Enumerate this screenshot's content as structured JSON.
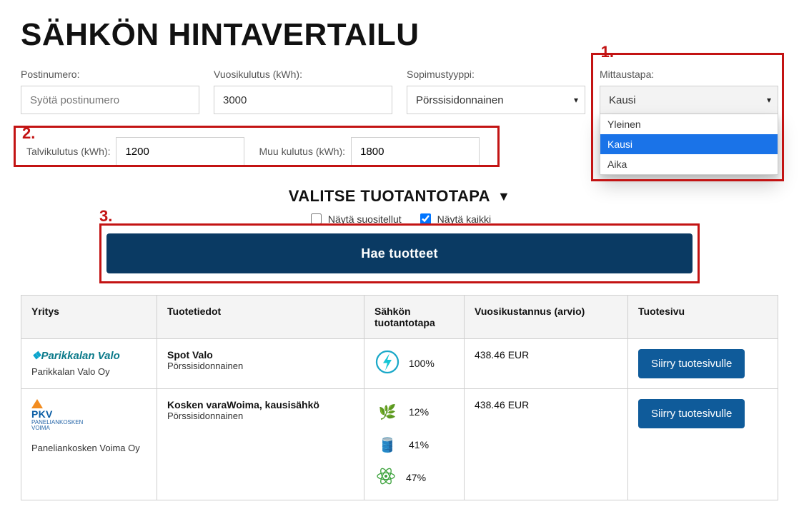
{
  "title": "SÄHKÖN HINTAVERTAILU",
  "annotations": {
    "n1": "1.",
    "n2": "2.",
    "n3": "3."
  },
  "filters": {
    "postal": {
      "label": "Postinumero:",
      "placeholder": "Syötä postinumero",
      "value": ""
    },
    "annual": {
      "label": "Vuosikulutus (kWh):",
      "value": "3000"
    },
    "contract": {
      "label": "Sopimustyyppi:",
      "selected": "Pörssisidonnainen"
    },
    "measurement": {
      "label": "Mittaustapa:",
      "selected": "Kausi",
      "options": [
        "Yleinen",
        "Kausi",
        "Aika"
      ]
    }
  },
  "row2": {
    "winter": {
      "label": "Talvikulutus (kWh):",
      "value": "1200"
    },
    "other": {
      "label": "Muu kulutus (kWh):",
      "value": "1800"
    }
  },
  "section": {
    "production_title": "VALITSE TUOTANTOTAPA"
  },
  "checks": {
    "recommended": {
      "label": "Näytä suositellut",
      "checked": false
    },
    "all": {
      "label": "Näytä kaikki",
      "checked": true
    }
  },
  "buttons": {
    "search": "Hae tuotteet",
    "go": "Siirry tuotesivulle"
  },
  "table": {
    "headers": {
      "company": "Yritys",
      "product": "Tuotetiedot",
      "mix": "Sähkön tuotantotapa",
      "annual_cost": "Vuosikustannus (arvio)",
      "page": "Tuotesivu"
    },
    "rows": [
      {
        "brand": {
          "logo": "parikalan-valo",
          "text": "Parikkalan Valo"
        },
        "company": "Parikkalan Valo Oy",
        "product_title": "Spot Valo",
        "product_sub": "Pörssisidonnainen",
        "mix": [
          {
            "icon": "bolt",
            "pct": "100%"
          }
        ],
        "annual_cost": "438.46 EUR"
      },
      {
        "brand": {
          "logo": "pkv",
          "text": "PKV"
        },
        "company": "Paneliankosken Voima Oy",
        "product_title": "Kosken varaWoima, kausisähkö",
        "product_sub": "Pörssisidonnainen",
        "mix": [
          {
            "icon": "renewables",
            "pct": "12%"
          },
          {
            "icon": "fossil",
            "pct": "41%"
          },
          {
            "icon": "nuclear",
            "pct": "47%"
          }
        ],
        "annual_cost": "438.46 EUR"
      }
    ]
  }
}
